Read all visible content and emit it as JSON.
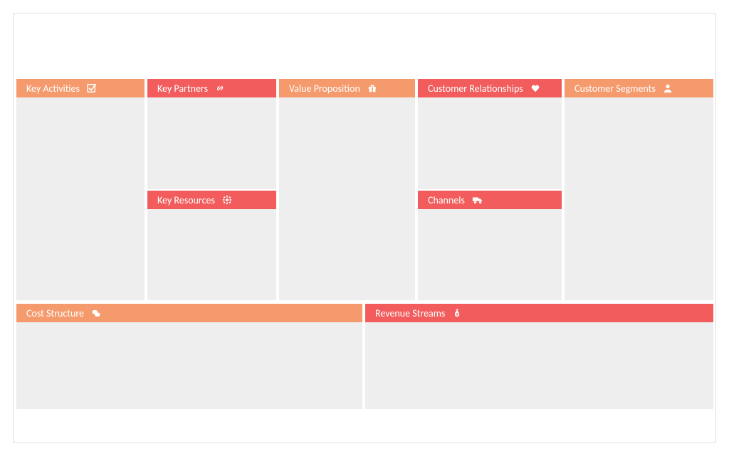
{
  "colors": {
    "orange": "#f59a6c",
    "coral": "#f25c5c",
    "panel": "#eeeeee"
  },
  "blocks": {
    "key_activities": {
      "label": "Key Activities",
      "icon": "check-square-icon"
    },
    "key_partners": {
      "label": "Key Partners",
      "icon": "link-icon"
    },
    "key_resources": {
      "label": "Key Resources",
      "icon": "gear-icon"
    },
    "value_proposition": {
      "label": "Value Proposition",
      "icon": "gift-icon"
    },
    "customer_relationships": {
      "label": "Customer Relationships",
      "icon": "heart-icon"
    },
    "channels": {
      "label": "Channels",
      "icon": "truck-icon"
    },
    "customer_segments": {
      "label": "Customer Segments",
      "icon": "user-icon"
    },
    "cost_structure": {
      "label": "Cost Structure",
      "icon": "coins-icon"
    },
    "revenue_streams": {
      "label": "Revenue Streams",
      "icon": "money-bag-icon"
    }
  }
}
